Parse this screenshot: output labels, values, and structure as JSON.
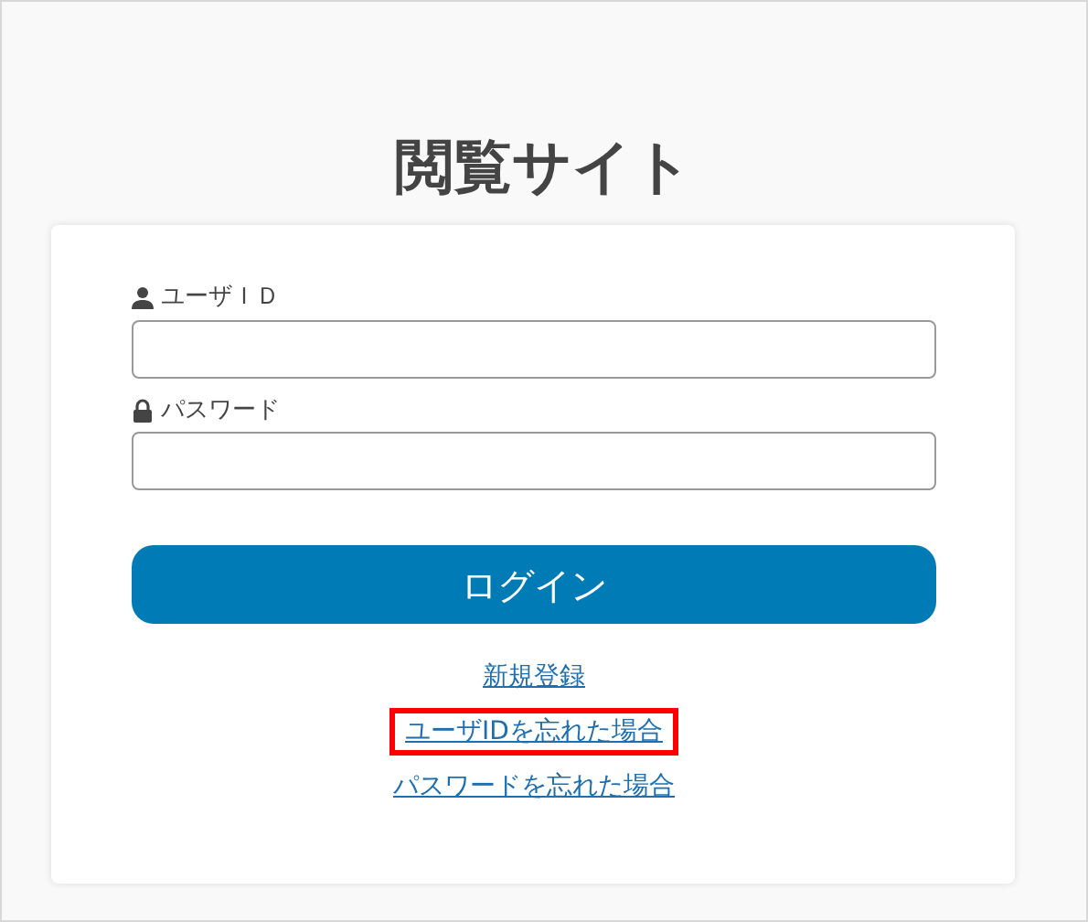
{
  "title": "閲覧サイト",
  "fields": [
    {
      "kind": "user",
      "label": "ユーザＩＤ"
    },
    {
      "kind": "password",
      "label": "パスワード"
    }
  ],
  "login_button": "ログイン",
  "links": [
    {
      "label": "新規登録",
      "highlighted": false
    },
    {
      "label": "ユーザIDを忘れた場合",
      "highlighted": true
    },
    {
      "label": "パスワードを忘れた場合",
      "highlighted": false
    }
  ]
}
